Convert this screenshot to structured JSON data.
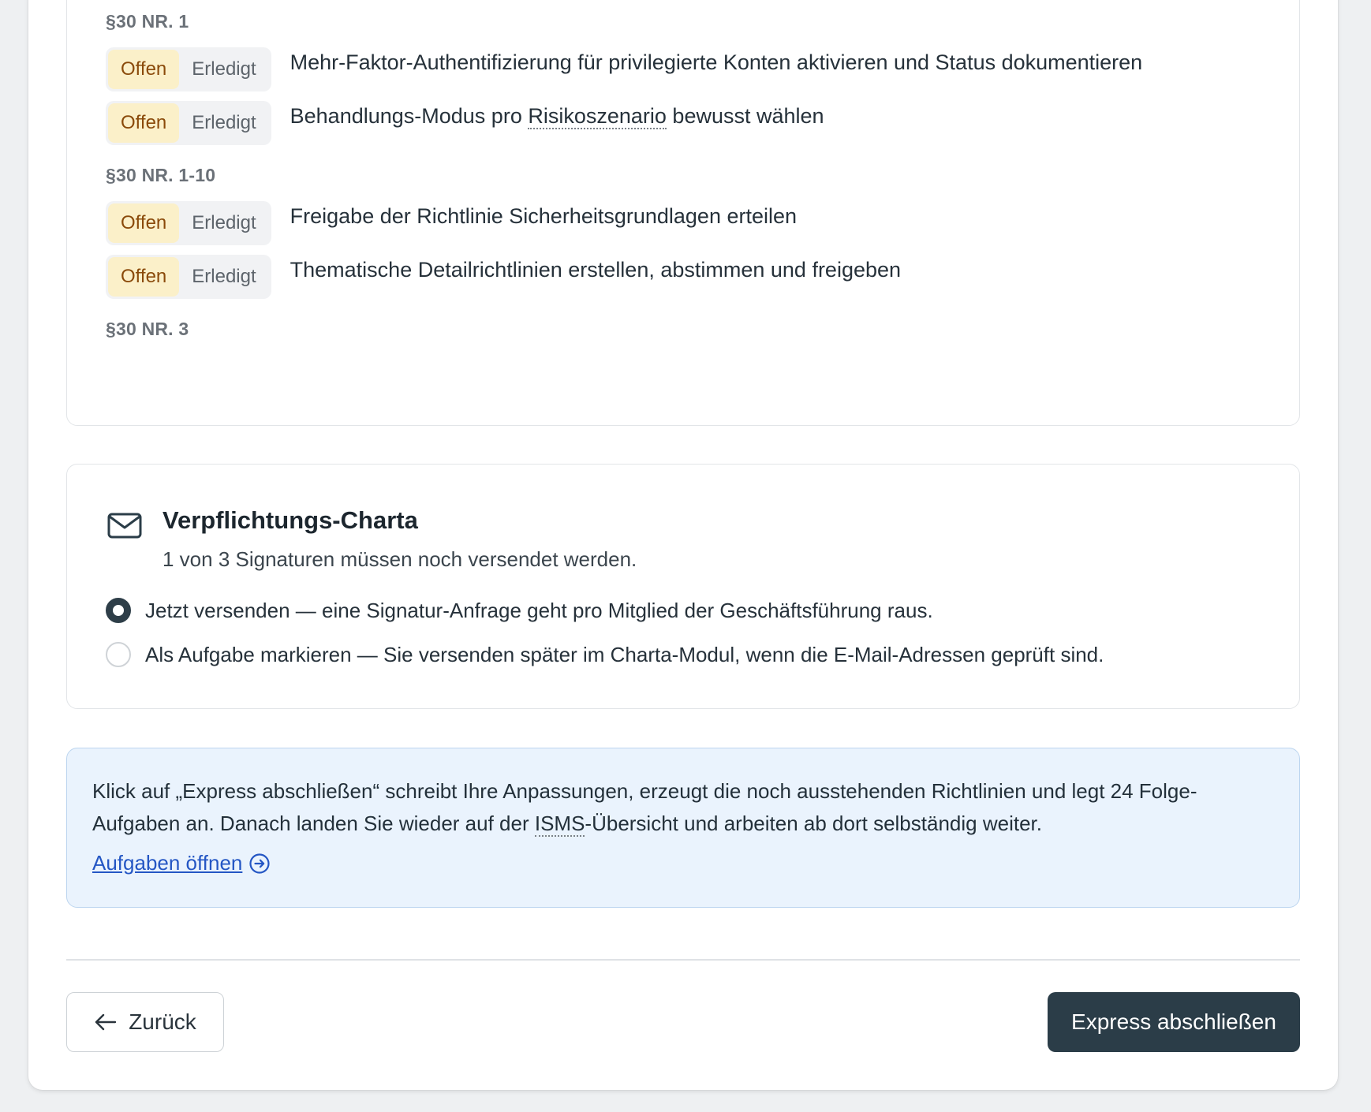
{
  "tasks": {
    "sections": [
      {
        "label": "§30 NR. 1",
        "items": [
          {
            "status_open": "Offen",
            "status_done": "Erledigt",
            "text": "Mehr-Faktor-Authentifizierung für privilegierte Konten aktivieren und Status dokumentieren"
          },
          {
            "status_open": "Offen",
            "status_done": "Erledigt",
            "text_before": "Behandlungs-Modus pro ",
            "text_term": "Risikoszenario",
            "text_after": " bewusst wählen"
          }
        ]
      },
      {
        "label": "§30 NR. 1-10",
        "items": [
          {
            "status_open": "Offen",
            "status_done": "Erledigt",
            "text": "Freigabe der Richtlinie Sicherheitsgrundlagen erteilen"
          },
          {
            "status_open": "Offen",
            "status_done": "Erledigt",
            "text": "Thematische Detailrichtlinien erstellen, abstimmen und freigeben"
          }
        ]
      },
      {
        "label": "§30 NR. 3",
        "items": []
      }
    ]
  },
  "charta": {
    "icon": "mail-icon",
    "title": "Verpflichtungs-Charta",
    "subtitle": "1 von 3 Signaturen müssen noch versendet werden.",
    "options": [
      {
        "label": "Jetzt versenden — eine Signatur-Anfrage geht pro Mitglied der Geschäftsführung raus.",
        "checked": true
      },
      {
        "label": "Als Aufgabe markieren — Sie versenden später im Charta-Modul, wenn die E-Mail-Adressen geprüft sind.",
        "checked": false
      }
    ]
  },
  "info": {
    "text_before": "Klick auf „Express abschließen“ schreibt Ihre Anpassungen, erzeugt die noch ausstehenden Richtlinien und legt 24 Folge-Aufgaben an. Danach landen Sie wieder auf der ",
    "text_term": "ISMS",
    "text_after": "-Übersicht und arbeiten ab dort selbständig weiter.",
    "link": "Aufgaben öffnen",
    "link_icon": "arrow-right-circle-icon"
  },
  "footer": {
    "back_label": "Zurück",
    "back_icon": "arrow-left-icon",
    "submit_label": "Express abschließen"
  },
  "colors": {
    "primary": "#2b3d48",
    "status_open_bg": "#fbf0c9",
    "status_open_text": "#8a4a0a",
    "info_bg": "#eaf3fd",
    "link": "#2456c4"
  }
}
